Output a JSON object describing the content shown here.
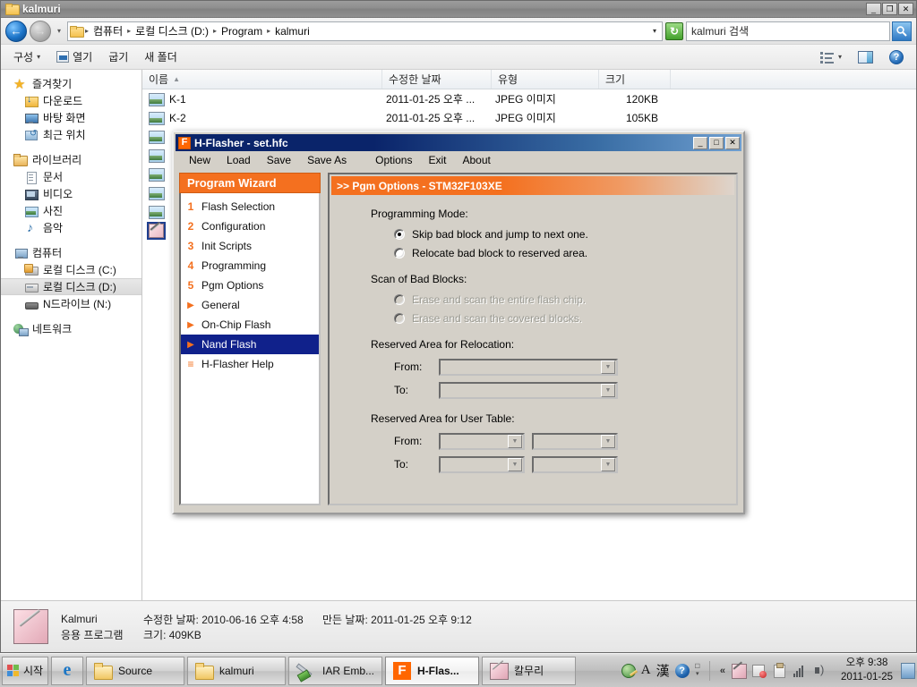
{
  "explorer": {
    "title": "kalmuri",
    "window_controls": {
      "minimize": "_",
      "restore": "❐",
      "close": "✕"
    },
    "address": {
      "crumbs": [
        "컴퓨터",
        "로컬 디스크 (D:)",
        "Program",
        "kalmuri"
      ],
      "separator": "▸",
      "dropdown_caret": "▾",
      "refresh_label": "↻"
    },
    "search": {
      "value": "kalmuri 검색",
      "icon": "search-icon"
    },
    "toolbar": {
      "organize": "구성",
      "open": "열기",
      "burn": "굽기",
      "new_folder": "새 폴더",
      "caret": "▾"
    },
    "nav_pane": {
      "groups": [
        {
          "header": {
            "label": "즐겨찾기",
            "icon": "star-icon"
          },
          "items": [
            {
              "label": "다운로드",
              "icon": "download-icon"
            },
            {
              "label": "바탕 화면",
              "icon": "desktop-icon"
            },
            {
              "label": "최근 위치",
              "icon": "recent-places-icon"
            }
          ]
        },
        {
          "header": {
            "label": "라이브러리",
            "icon": "library-icon"
          },
          "items": [
            {
              "label": "문서",
              "icon": "documents-icon"
            },
            {
              "label": "비디오",
              "icon": "videos-icon"
            },
            {
              "label": "사진",
              "icon": "pictures-icon"
            },
            {
              "label": "음악",
              "icon": "music-icon"
            }
          ]
        },
        {
          "header": {
            "label": "컴퓨터",
            "icon": "computer-icon"
          },
          "items": [
            {
              "label": "로컬 디스크 (C:)",
              "icon": "disk-c-icon",
              "selected": false
            },
            {
              "label": "로컬 디스크 (D:)",
              "icon": "disk-d-icon",
              "selected": true
            },
            {
              "label": "N드라이브 (N:)",
              "icon": "network-drive-icon",
              "selected": false
            }
          ]
        },
        {
          "header": {
            "label": "네트워크",
            "icon": "network-icon"
          },
          "items": []
        }
      ]
    },
    "file_list": {
      "columns": [
        {
          "label": "이름",
          "sorted": true,
          "sort_arrow": "▲"
        },
        {
          "label": "수정한 날짜"
        },
        {
          "label": "유형"
        },
        {
          "label": "크기"
        }
      ],
      "rows": [
        {
          "name": "K-1",
          "date": "2011-01-25 오후 ...",
          "type": "JPEG 이미지",
          "size": "120KB",
          "icon": "jpeg-icon"
        },
        {
          "name": "K-2",
          "date": "2011-01-25 오후 ...",
          "type": "JPEG 이미지",
          "size": "105KB",
          "icon": "jpeg-icon"
        },
        {
          "name": "",
          "date": "",
          "type": "",
          "size": "",
          "icon": "jpeg-icon"
        },
        {
          "name": "",
          "date": "",
          "type": "",
          "size": "",
          "icon": "jpeg-icon"
        },
        {
          "name": "",
          "date": "",
          "type": "",
          "size": "",
          "icon": "jpeg-icon"
        },
        {
          "name": "",
          "date": "",
          "type": "",
          "size": "",
          "icon": "jpeg-icon"
        },
        {
          "name": "",
          "date": "",
          "type": "",
          "size": "",
          "icon": "jpeg-icon"
        },
        {
          "name": "",
          "date": "",
          "type": "",
          "size": "",
          "icon": "knife-icon",
          "selected": true
        }
      ]
    },
    "details": {
      "name": "Kalmuri",
      "kind": "응용 프로그램",
      "modified_label": "수정한 날짜: 2010-06-16 오후 4:58",
      "size_label": "크기: 409KB",
      "created_label": "만든 날짜: 2011-01-25 오후 9:12",
      "icon": "kalmuri-app-icon"
    }
  },
  "hflasher": {
    "title": "H-Flasher - set.hfc",
    "app_icon_letter": "F",
    "window_controls": {
      "minimize": "_",
      "restore": "□",
      "close": "✕"
    },
    "menu": [
      "New",
      "Load",
      "Save",
      "Save As",
      "Options",
      "Exit",
      "About"
    ],
    "wizard": {
      "header": "Program Wizard",
      "items": [
        {
          "marker": "1",
          "label": "Flash Selection",
          "type": "num",
          "active": false
        },
        {
          "marker": "2",
          "label": "Configuration",
          "type": "num",
          "active": false
        },
        {
          "marker": "3",
          "label": "Init Scripts",
          "type": "num",
          "active": false
        },
        {
          "marker": "4",
          "label": "Programming",
          "type": "num",
          "active": false
        },
        {
          "marker": "5",
          "label": "Pgm Options",
          "type": "num",
          "active": false
        },
        {
          "marker": "▶",
          "label": "General",
          "type": "arrow",
          "active": false
        },
        {
          "marker": "▶",
          "label": "On-Chip Flash",
          "type": "arrow",
          "active": false
        },
        {
          "marker": "▶",
          "label": "Nand Flash",
          "type": "arrow",
          "active": true
        },
        {
          "marker": "≡",
          "label": "H-Flasher Help",
          "type": "num",
          "active": false
        }
      ]
    },
    "options": {
      "header": ">> Pgm Options - STM32F103XE",
      "programming_mode_label": "Programming Mode:",
      "programming_mode_options": [
        {
          "label": "Skip bad block and jump to next one.",
          "selected": true,
          "disabled": false
        },
        {
          "label": "Relocate bad block to reserved area.",
          "selected": false,
          "disabled": false
        }
      ],
      "scan_label": "Scan of Bad Blocks:",
      "scan_options": [
        {
          "label": "Erase and scan the entire flash chip.",
          "selected": false,
          "disabled": true
        },
        {
          "label": "Erase and scan the covered blocks.",
          "selected": false,
          "disabled": true
        }
      ],
      "reloc_label": "Reserved Area for Relocation:",
      "reloc_fields": [
        {
          "label": "From:",
          "value": ""
        },
        {
          "label": "To:",
          "value": ""
        }
      ],
      "usertable_label": "Reserved Area for User Table:",
      "usertable_fields": [
        {
          "label": "From:",
          "value_a": "",
          "value_b": ""
        },
        {
          "label": "To:",
          "value_a": "",
          "value_b": ""
        }
      ],
      "combo_caret": "▼"
    }
  },
  "taskbar": {
    "start_label": "시작",
    "ie_glyph": "e",
    "buttons": [
      {
        "label": "Source",
        "icon": "folder-icon",
        "active": false
      },
      {
        "label": "kalmuri",
        "icon": "folder-icon",
        "active": false
      },
      {
        "label": "IAR Emb...",
        "icon": "iar-icon",
        "active": false
      },
      {
        "label": "H-Flas...",
        "icon": "hflasher-icon",
        "active": true
      },
      {
        "label": "칼무리",
        "icon": "kalmuri-icon",
        "active": false
      }
    ],
    "tray": {
      "ime_globe": "ime-globe-icon",
      "ime_alpha": "A",
      "ime_han": "漢",
      "help": "?",
      "ime_more": "▾",
      "chevron": "«",
      "icons": [
        "kalmuri-tray-icon",
        "network-error-icon",
        "clipboard-icon",
        "signal-icon",
        "volume-icon"
      ],
      "time": "오후 9:38",
      "date": "2011-01-25",
      "show_desktop": "show-desktop-button"
    }
  },
  "colors": {
    "accent_orange": "#f4701f",
    "wizard_selected": "#10218b",
    "title_blue": "#0a246a",
    "dialog_face": "#d4d0c8"
  }
}
